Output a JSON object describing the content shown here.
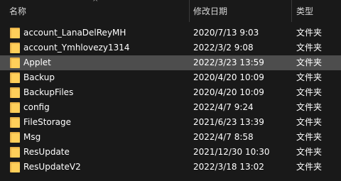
{
  "header": {
    "name": "名称",
    "date": "修改日期",
    "type": "类型",
    "sort_icon": "^"
  },
  "rows": [
    {
      "name": "account_LanaDelReyMH",
      "date": "2020/7/13 9:03",
      "type": "文件夹",
      "icon": "folder-icon"
    },
    {
      "name": "account_Ymhlovezy1314",
      "date": "2022/3/2 9:08",
      "type": "文件夹",
      "icon": "folder-icon"
    },
    {
      "name": "Applet",
      "date": "2022/3/23 13:59",
      "type": "文件夹",
      "icon": "folder-icon",
      "selected": true
    },
    {
      "name": "Backup",
      "date": "2020/4/20 10:09",
      "type": "文件夹",
      "icon": "folder-icon"
    },
    {
      "name": "BackupFiles",
      "date": "2020/4/20 10:09",
      "type": "文件夹",
      "icon": "folder-icon"
    },
    {
      "name": "config",
      "date": "2022/4/7 9:24",
      "type": "文件夹",
      "icon": "folder-icon"
    },
    {
      "name": "FileStorage",
      "date": "2021/6/23 13:39",
      "type": "文件夹",
      "icon": "folder-icon"
    },
    {
      "name": "Msg",
      "date": "2022/4/7 8:58",
      "type": "文件夹",
      "icon": "folder-icon"
    },
    {
      "name": "ResUpdate",
      "date": "2021/12/30 10:30",
      "type": "文件夹",
      "icon": "folder-icon"
    },
    {
      "name": "ResUpdateV2",
      "date": "2022/3/18 13:02",
      "type": "文件夹",
      "icon": "folder-icon"
    }
  ],
  "colors": {
    "background": "#191919",
    "selected": "#4d4d4d",
    "folder": "#ffcf5a"
  }
}
